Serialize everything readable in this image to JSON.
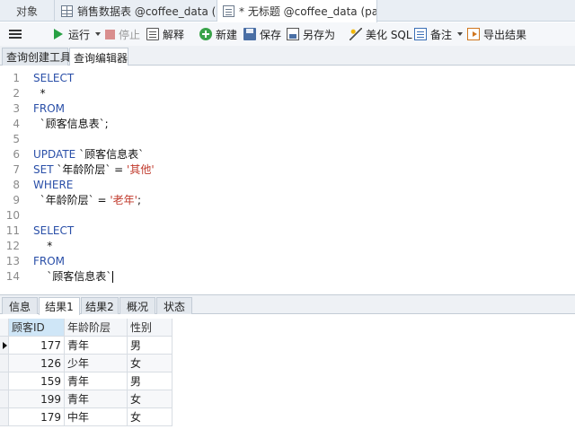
{
  "doc_tabs": {
    "objects": "对象",
    "sales": "销售数据表 @coffee_data (p...",
    "untitled": "* 无标题 @coffee_data (pac..."
  },
  "toolbar": {
    "run": "运行",
    "stop": "停止",
    "explain": "解释",
    "new": "新建",
    "save": "保存",
    "save_as": "另存为",
    "beautify": "美化 SQL",
    "note": "备注",
    "export": "导出结果"
  },
  "sub_tabs": {
    "query_builder": "查询创建工具",
    "query_editor": "查询编辑器"
  },
  "editor": {
    "lines": [
      {
        "n": "1",
        "kw": "SELECT",
        "rest": ""
      },
      {
        "n": "2",
        "indent": "  ",
        "text": "*"
      },
      {
        "n": "3",
        "kw": "FROM",
        "rest": ""
      },
      {
        "n": "4",
        "indent": "  ",
        "text": "`顾客信息表`;"
      },
      {
        "n": "5"
      },
      {
        "n": "6",
        "kw": "UPDATE",
        "rest": " `顾客信息表`"
      },
      {
        "n": "7",
        "kw": "SET",
        "rest": " `年龄阶层` = ",
        "str": "'其他'"
      },
      {
        "n": "8",
        "kw": "WHERE",
        "rest": ""
      },
      {
        "n": "9",
        "indent": "  ",
        "text": "`年龄阶层` = ",
        "str": "'老年'",
        "tail": ";"
      },
      {
        "n": "10"
      },
      {
        "n": "11",
        "kw": "SELECT",
        "rest": ""
      },
      {
        "n": "12",
        "indent": "    ",
        "text": "*"
      },
      {
        "n": "13",
        "kw": "FROM",
        "rest": ""
      },
      {
        "n": "14",
        "indent": "    ",
        "text": "`顾客信息表`"
      }
    ]
  },
  "result_tabs": {
    "info": "信息",
    "result1": "结果1",
    "result2": "结果2",
    "overview": "概况",
    "status": "状态"
  },
  "grid": {
    "columns": [
      "顾客ID",
      "年龄阶层",
      "性别"
    ],
    "rows": [
      [
        "177",
        "青年",
        "男"
      ],
      [
        "126",
        "少年",
        "女"
      ],
      [
        "159",
        "青年",
        "男"
      ],
      [
        "199",
        "青年",
        "女"
      ],
      [
        "179",
        "中年",
        "女"
      ]
    ]
  }
}
